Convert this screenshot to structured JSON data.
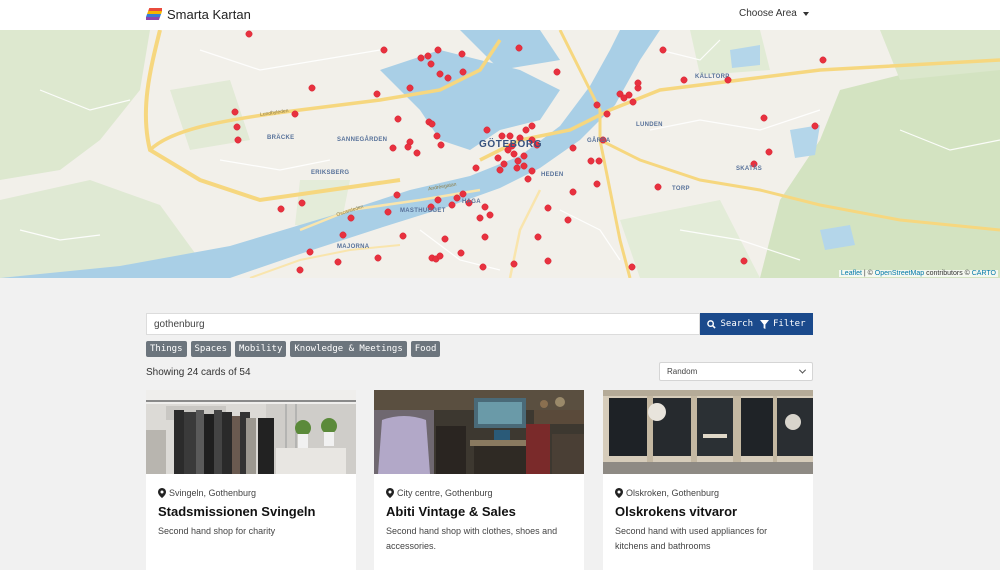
{
  "header": {
    "brand_name": "Smarta Kartan",
    "choose_area_label": "Choose Area"
  },
  "map": {
    "labels": {
      "gothenburg": "GÖTEBORG",
      "kalltorp": "KÄLLTORP",
      "lunden": "LUNDEN",
      "garda": "GÅRDA",
      "heden": "HEDEN",
      "torp": "TORP",
      "skatas": "SKATÅS",
      "bracke": "BRÄCKE",
      "sannegarden": "SANNEGÅRDEN",
      "eriksberg": "ERIKSBERG",
      "masthugget": "MASTHUGGET",
      "haga": "HAGA",
      "majorna": "MAJORNA"
    },
    "road_labels": {
      "lundbyleden": "Lundbyleden",
      "oscarsleden": "Oscarsleden",
      "andreegatan": "Andréegatan"
    },
    "attribution": {
      "leaflet": "Leaflet",
      "sep1": " | © ",
      "osm": "OpenStreetMap",
      "mid": " contributors © ",
      "carto": "CARTO"
    },
    "marker_color": "#e8313f"
  },
  "search": {
    "value": "gothenburg",
    "search_label": "Search",
    "filter_label": "Filter"
  },
  "tags": [
    "Things",
    "Spaces",
    "Mobility",
    "Knowledge & Meetings",
    "Food"
  ],
  "results": {
    "showing_text": "Showing 24 cards of 54",
    "sort_value": "Random"
  },
  "cards": [
    {
      "location": "Svingeln, Gothenburg",
      "title": "Stadsmissionen Svingeln",
      "description": "Second hand shop for charity"
    },
    {
      "location": "City centre, Gothenburg",
      "title": "Abiti Vintage & Sales",
      "description": "Second hand shop with clothes, shoes and accessories."
    },
    {
      "location": "Olskroken, Gothenburg",
      "title": "Olskrokens vitvaror",
      "description": "Second hand with used appliances for kitchens and bathrooms"
    }
  ]
}
